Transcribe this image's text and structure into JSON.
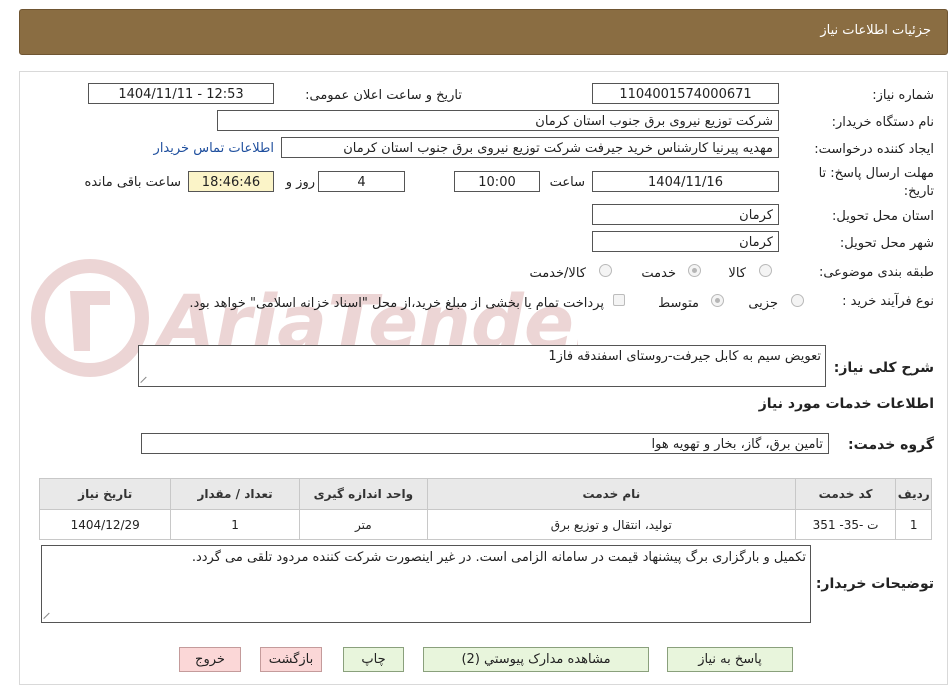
{
  "header": {
    "title": "جزئیات اطلاعات نیاز"
  },
  "form": {
    "need_number_label": "شماره نیاز:",
    "need_number": "1104001574000671",
    "announce_label": "تاریخ و ساعت اعلان عمومی:",
    "announce_value": "1404/11/11 - 12:53",
    "buyer_org_label": "نام دستگاه خریدار:",
    "buyer_org": "شرکت توزیع نیروی برق جنوب استان کرمان",
    "creator_label": "ایجاد کننده درخواست:",
    "creator": "مهدیه پیرنیا کارشناس خرید جیرفت شرکت توزیع نیروی برق جنوب استان کرمان",
    "contact_link": "اطلاعات تماس خریدار",
    "deadline_label_1": "مهلت ارسال پاسخ: تا",
    "deadline_label_2": "تاریخ:",
    "deadline_date": "1404/11/16",
    "time_label": "ساعت",
    "deadline_time": "10:00",
    "days_value": "4",
    "days_label": "روز و",
    "remaining_time": "18:46:46",
    "remaining_label": "ساعت باقی مانده",
    "province_label": "استان محل تحویل:",
    "province": "کرمان",
    "city_label": "شهر محل تحویل:",
    "city": "کرمان",
    "category_label": "طبقه بندی موضوعی:",
    "category_options": [
      "کالا",
      "خدمت",
      "کالا/خدمت"
    ],
    "category_selected": "خدمت",
    "process_label": "نوع فرآیند خرید :",
    "process_options": [
      "جزیی",
      "متوسط"
    ],
    "process_selected": "متوسط",
    "payment_note": "پرداخت تمام یا بخشی از مبلغ خرید،از محل \"اسناد خزانه اسلامی\" خواهد بود."
  },
  "description": {
    "label": "شرح کلی نیاز:",
    "value": "تعویض سیم به کابل جیرفت-روستای اسفندقه فاز1"
  },
  "services": {
    "section_title": "اطلاعات خدمات مورد نیاز",
    "group_label": "گروه خدمت:",
    "group_value": "تامین برق، گاز، بخار و تهویه هوا",
    "columns": [
      "ردیف",
      "کد خدمت",
      "نام خدمت",
      "واحد اندازه گیری",
      "تعداد / مقدار",
      "تاریخ نیاز"
    ],
    "rows": [
      [
        "1",
        "ت -35- 351",
        "تولید، انتقال و توزیع برق",
        "متر",
        "1",
        "1404/12/29"
      ]
    ]
  },
  "buyer_notes": {
    "label": "توضیحات خریدار:",
    "value": "تکمیل و بارگزاری برگ پیشنهاد قیمت در سامانه الزامی است. در غیر اینصورت شرکت کننده مردود تلقی می گردد."
  },
  "buttons": {
    "reply": "پاسخ به نیاز",
    "attachments": "مشاهده مدارک پیوستي (2)",
    "print": "چاپ",
    "back": "بازگشت",
    "exit": "خروج"
  },
  "watermark": {
    "text": "AriaTender.neT"
  },
  "colors": {
    "header": "#8a6d42",
    "button_green": "#e8f5dc",
    "button_red": "#fbd7d7",
    "link": "#1f4f9e"
  }
}
